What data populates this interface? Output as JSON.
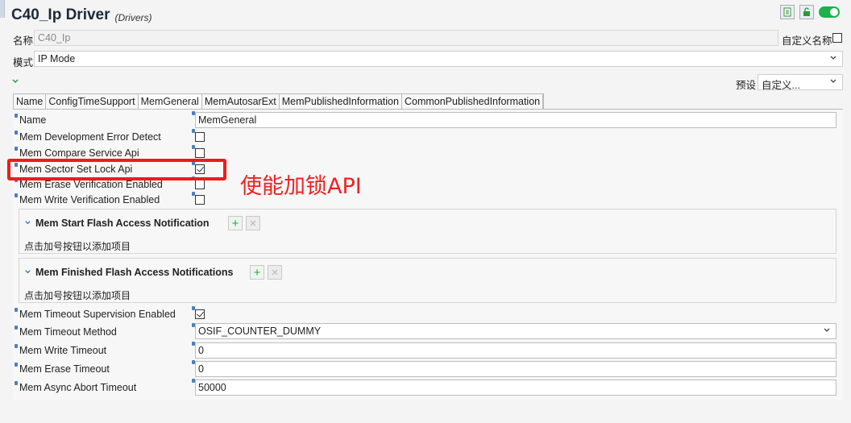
{
  "header": {
    "title": "C40_Ip Driver",
    "subtitle": "(Drivers)"
  },
  "name_row": {
    "label": "名称",
    "value": "C40_Ip",
    "custom_name_label": "自定义名称"
  },
  "mode_row": {
    "label": "模式",
    "value": "IP Mode"
  },
  "preset": {
    "label": "预设",
    "value": "自定义..."
  },
  "tabs": [
    {
      "label": "Name",
      "active": false
    },
    {
      "label": "ConfigTimeSupport",
      "active": false
    },
    {
      "label": "MemGeneral",
      "active": true
    },
    {
      "label": "MemAutosarExt",
      "active": false
    },
    {
      "label": "MemPublishedInformation",
      "active": false
    },
    {
      "label": "CommonPublishedInformation",
      "active": false
    }
  ],
  "params": {
    "name": {
      "label": "Name",
      "value": "MemGeneral"
    },
    "dev_error_detect": {
      "label": "Mem Development Error Detect",
      "checked": false
    },
    "compare_service_api": {
      "label": "Mem Compare Service Api",
      "checked": false
    },
    "sector_set_lock_api": {
      "label": "Mem Sector Set Lock Api",
      "checked": true
    },
    "erase_verification": {
      "label": "Mem Erase Verification Enabled",
      "checked": false
    },
    "write_verification": {
      "label": "Mem Write Verification Enabled",
      "checked": false
    },
    "timeout_supervision": {
      "label": "Mem Timeout Supervision Enabled",
      "checked": true
    },
    "timeout_method": {
      "label": "Mem Timeout Method",
      "value": "OSIF_COUNTER_DUMMY"
    },
    "write_timeout": {
      "label": "Mem Write Timeout",
      "value": "0"
    },
    "erase_timeout": {
      "label": "Mem Erase Timeout",
      "value": "0"
    },
    "async_abort_timeout": {
      "label": "Mem Async Abort Timeout",
      "value": "50000"
    }
  },
  "groups": {
    "start_notification": {
      "title": "Mem Start Flash Access Notification",
      "hint": "点击加号按钮以添加项目",
      "add": "+",
      "remove": "×"
    },
    "finished_notifications": {
      "title": "Mem Finished Flash Access Notifications",
      "hint": "点击加号按钮以添加项目",
      "add": "+",
      "remove": "×"
    }
  },
  "annotation": {
    "text": "使能加锁API",
    "color": "#ee2222"
  },
  "colors": {
    "toggle_on": "#19b34a",
    "param_marker": "#4a7fc1",
    "highlight": "#ee1c1c"
  }
}
